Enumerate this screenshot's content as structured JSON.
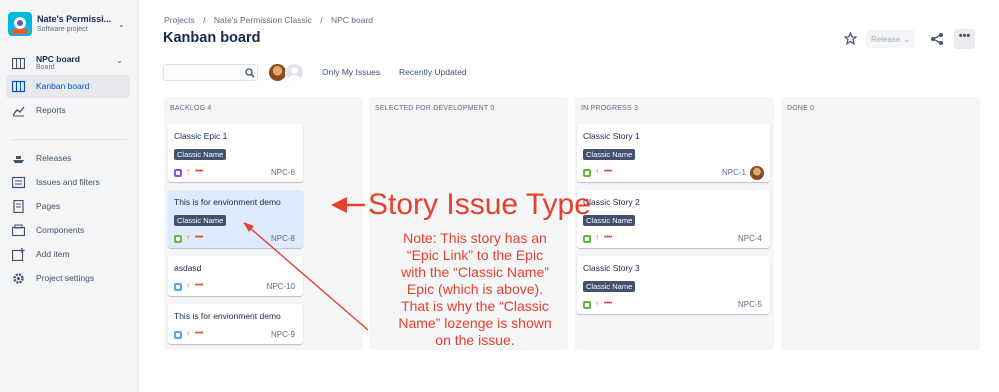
{
  "sidebar": {
    "project_name": "Nate's Permissi...",
    "project_type": "Software project",
    "board_name": "NPC board",
    "board_sub": "Board",
    "items": [
      {
        "label": "Kanban board"
      },
      {
        "label": "Reports"
      },
      {
        "label": "Releases"
      },
      {
        "label": "Issues and filters"
      },
      {
        "label": "Pages"
      },
      {
        "label": "Components"
      },
      {
        "label": "Add item"
      },
      {
        "label": "Project settings"
      }
    ]
  },
  "header": {
    "breadcrumbs": [
      "Projects",
      "/",
      "Nate's Permission Classic",
      "/",
      "NPC board"
    ],
    "title": "Kanban board",
    "release_label": "Release",
    "more_label": "•••"
  },
  "filters": {
    "search_placeholder": "",
    "only_my_issues": "Only My Issues",
    "recently_updated": "Recently Updated"
  },
  "columns": [
    {
      "header": "BACKLOG 4",
      "cards": [
        {
          "title": "Classic Epic 1",
          "lozenge": "Classic Name",
          "type": "epic",
          "key": "NPC-6",
          "points": "••••"
        },
        {
          "title": "This is for envionment demo",
          "lozenge": "Classic Name",
          "type": "story",
          "key": "NPC-8",
          "points": "••••"
        },
        {
          "title": "asdasd",
          "type": "task",
          "key": "NPC-10",
          "points": "••••"
        },
        {
          "title": "This is for envionment demo",
          "type": "task",
          "key": "NPC-9",
          "points": "••••"
        }
      ]
    },
    {
      "header": "SELECTED FOR DEVELOPMENT 0",
      "cards": []
    },
    {
      "header": "IN PROGRESS 3",
      "cards": [
        {
          "title": "Classic Story 1",
          "lozenge": "Classic Name",
          "type": "story",
          "key": "NPC-1",
          "points": "••••"
        },
        {
          "title": "Classic Story 2",
          "lozenge": "Classic Name",
          "type": "story",
          "key": "NPC-4",
          "points": "••••"
        },
        {
          "title": "Classic Story 3",
          "lozenge": "Classic Name",
          "type": "story",
          "key": "NPC-5",
          "points": "••••"
        }
      ]
    },
    {
      "header": "DONE 0",
      "cards": []
    }
  ],
  "annotation": {
    "title": "Story Issue Type",
    "note_lines": [
      "Note: This story has an",
      "“Epic Link” to the Epic",
      "with the “Classic Name”",
      "Epic (which is above).",
      "That is why the “Classic",
      "Name” lozenge is shown",
      "on the issue."
    ],
    "color": "#e8402e"
  },
  "colors": {
    "accent": "#0052cc",
    "lozenge_bg": "#42526e",
    "selected_card": "#deebff",
    "column_bg": "#f4f5f7"
  }
}
